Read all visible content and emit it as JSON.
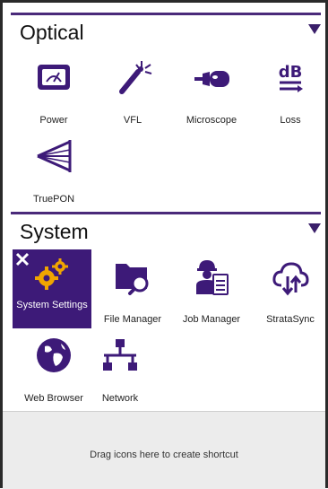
{
  "colors": {
    "accent": "#4a1a8a",
    "selected_bg": "#3d1a78",
    "shortcut_bg": "#ececec"
  },
  "optical": {
    "title": "Optical",
    "tiles": [
      {
        "label": "Power",
        "icon": "power-meter-icon"
      },
      {
        "label": "VFL",
        "icon": "vfl-wand-icon"
      },
      {
        "label": "Microscope",
        "icon": "microscope-icon"
      },
      {
        "label": "Loss",
        "icon": "db-loss-icon"
      },
      {
        "label": "TruePON",
        "icon": "truepon-splitter-icon"
      }
    ]
  },
  "system": {
    "title": "System",
    "tiles": [
      {
        "label": "System Settings",
        "icon": "gears-icon",
        "selected": true
      },
      {
        "label": "File Manager",
        "icon": "folder-search-icon"
      },
      {
        "label": "Job Manager",
        "icon": "worker-clipboard-icon"
      },
      {
        "label": "StrataSync",
        "icon": "cloud-sync-icon"
      },
      {
        "label": "Web Browser",
        "icon": "globe-icon"
      },
      {
        "label": "Network",
        "icon": "network-icon"
      }
    ]
  },
  "shortcut": {
    "text": "Drag icons here to create shortcut"
  }
}
